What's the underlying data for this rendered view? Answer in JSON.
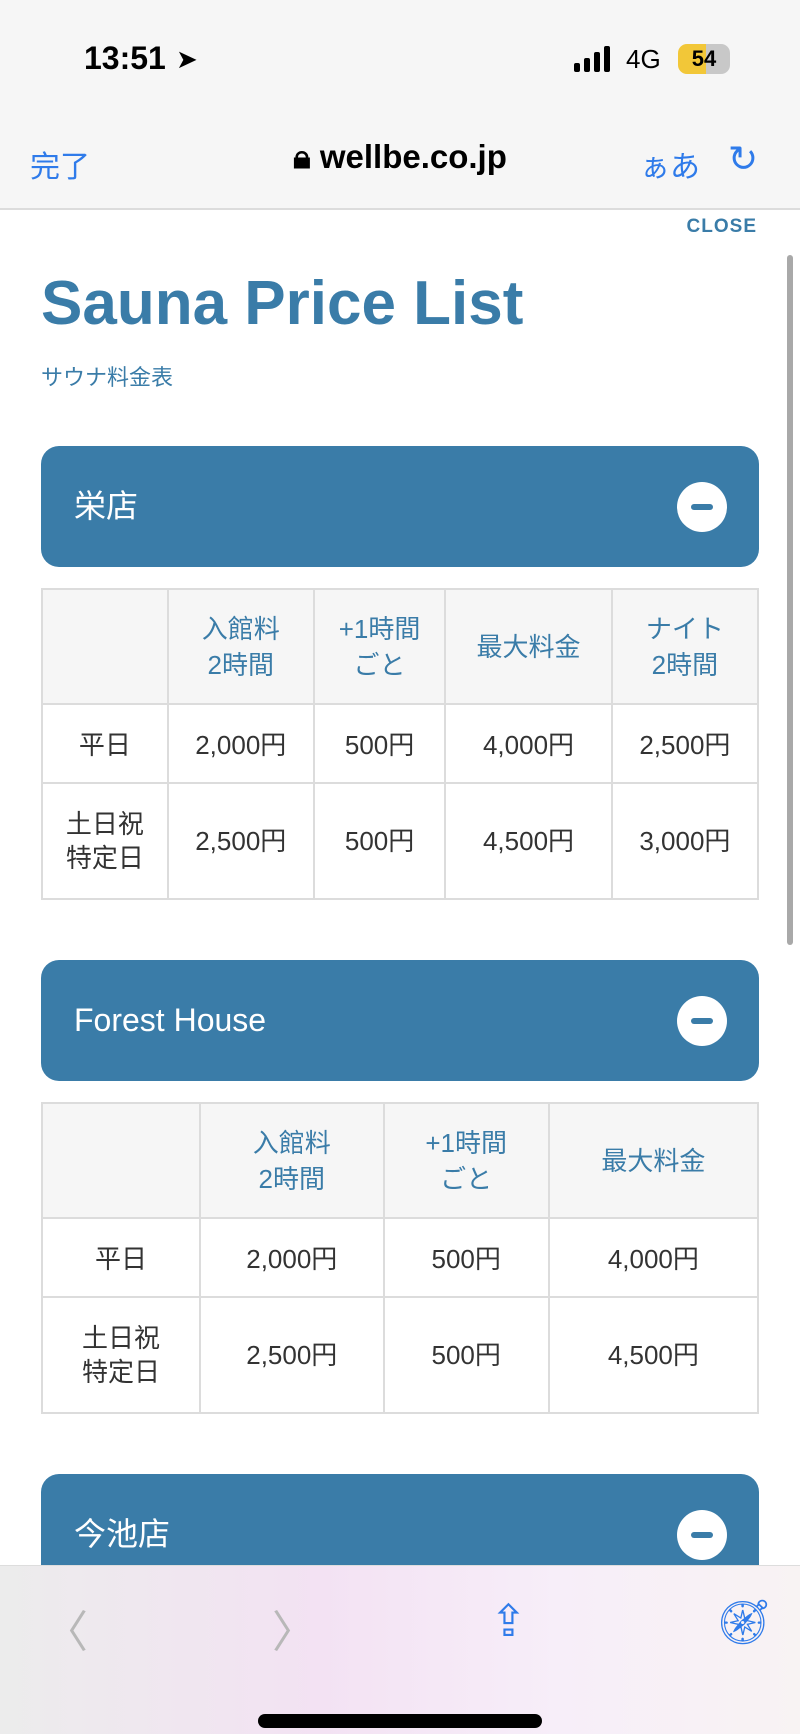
{
  "status": {
    "time": "13:51",
    "network": "4G",
    "battery": "54"
  },
  "browser": {
    "done": "完了",
    "url": "wellbe.co.jp",
    "text_size": "ぁあ"
  },
  "page": {
    "close": "CLOSE",
    "title": "Sauna Price List",
    "subtitle": "サウナ料金表"
  },
  "sections": [
    {
      "name": "栄店",
      "headers": [
        "",
        "入館料\n2時間",
        "+1時間\nごと",
        "最大料金",
        "ナイト\n2時間"
      ],
      "rows": [
        [
          "平日",
          "2,000円",
          "500円",
          "4,000円",
          "2,500円"
        ],
        [
          "土日祝\n特定日",
          "2,500円",
          "500円",
          "4,500円",
          "3,000円"
        ]
      ]
    },
    {
      "name": "Forest House",
      "headers": [
        "",
        "入館料\n2時間",
        "+1時間\nごと",
        "最大料金"
      ],
      "rows": [
        [
          "平日",
          "2,000円",
          "500円",
          "4,000円"
        ],
        [
          "土日祝\n特定日",
          "2,500円",
          "500円",
          "4,500円"
        ]
      ]
    },
    {
      "name": "今池店"
    }
  ],
  "colors": {
    "accent": "#3a7ca8",
    "ios_blue": "#2f7bea"
  }
}
